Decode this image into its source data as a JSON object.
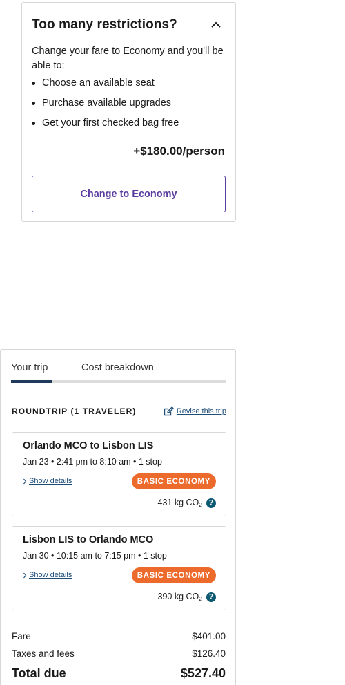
{
  "restrictions": {
    "title": "Too many restrictions?",
    "intro": "Change your fare to Economy and you'll be able to:",
    "benefits": [
      "Choose an available seat",
      "Purchase available upgrades",
      "Get your first checked bag free"
    ],
    "upgrade_price": "+$180.00/person",
    "change_button_label": "Change to Economy"
  },
  "trip": {
    "tabs": [
      {
        "label": "Your trip",
        "active": true
      },
      {
        "label": "Cost breakdown",
        "active": false
      }
    ],
    "trip_type": "ROUNDTRIP (1 TRAVELER)",
    "revise_label": "Revise this trip",
    "segments": [
      {
        "route": "Orlando MCO to Lisbon LIS",
        "time": "Jan 23 • 2:41 pm to 8:10 am • 1 stop",
        "details_label": "Show details",
        "fare_class": "BASIC ECONOMY",
        "co2_value": "431 kg CO",
        "co2_sub": "2"
      },
      {
        "route": "Lisbon LIS to Orlando MCO",
        "time": "Jan 30 • 10:15 am to 7:15 pm • 1 stop",
        "details_label": "Show details",
        "fare_class": "BASIC ECONOMY",
        "co2_value": "390 kg CO",
        "co2_sub": "2"
      }
    ],
    "costs": {
      "fare_label": "Fare",
      "fare_value": "$401.00",
      "taxes_label": "Taxes and fees",
      "taxes_value": "$126.40",
      "total_label": "Total due",
      "total_value": "$527.40"
    }
  },
  "colors": {
    "accent_purple": "#5a3d9e",
    "badge_orange": "#ec6a2c",
    "link_blue": "#1f4e79",
    "info_teal": "#0e5a73",
    "tab_active": "#1f3b5c"
  },
  "icons": {
    "collapse": "chevron-up-icon",
    "revise": "edit-icon",
    "details": "chevron-right-icon",
    "info": "info-icon"
  }
}
